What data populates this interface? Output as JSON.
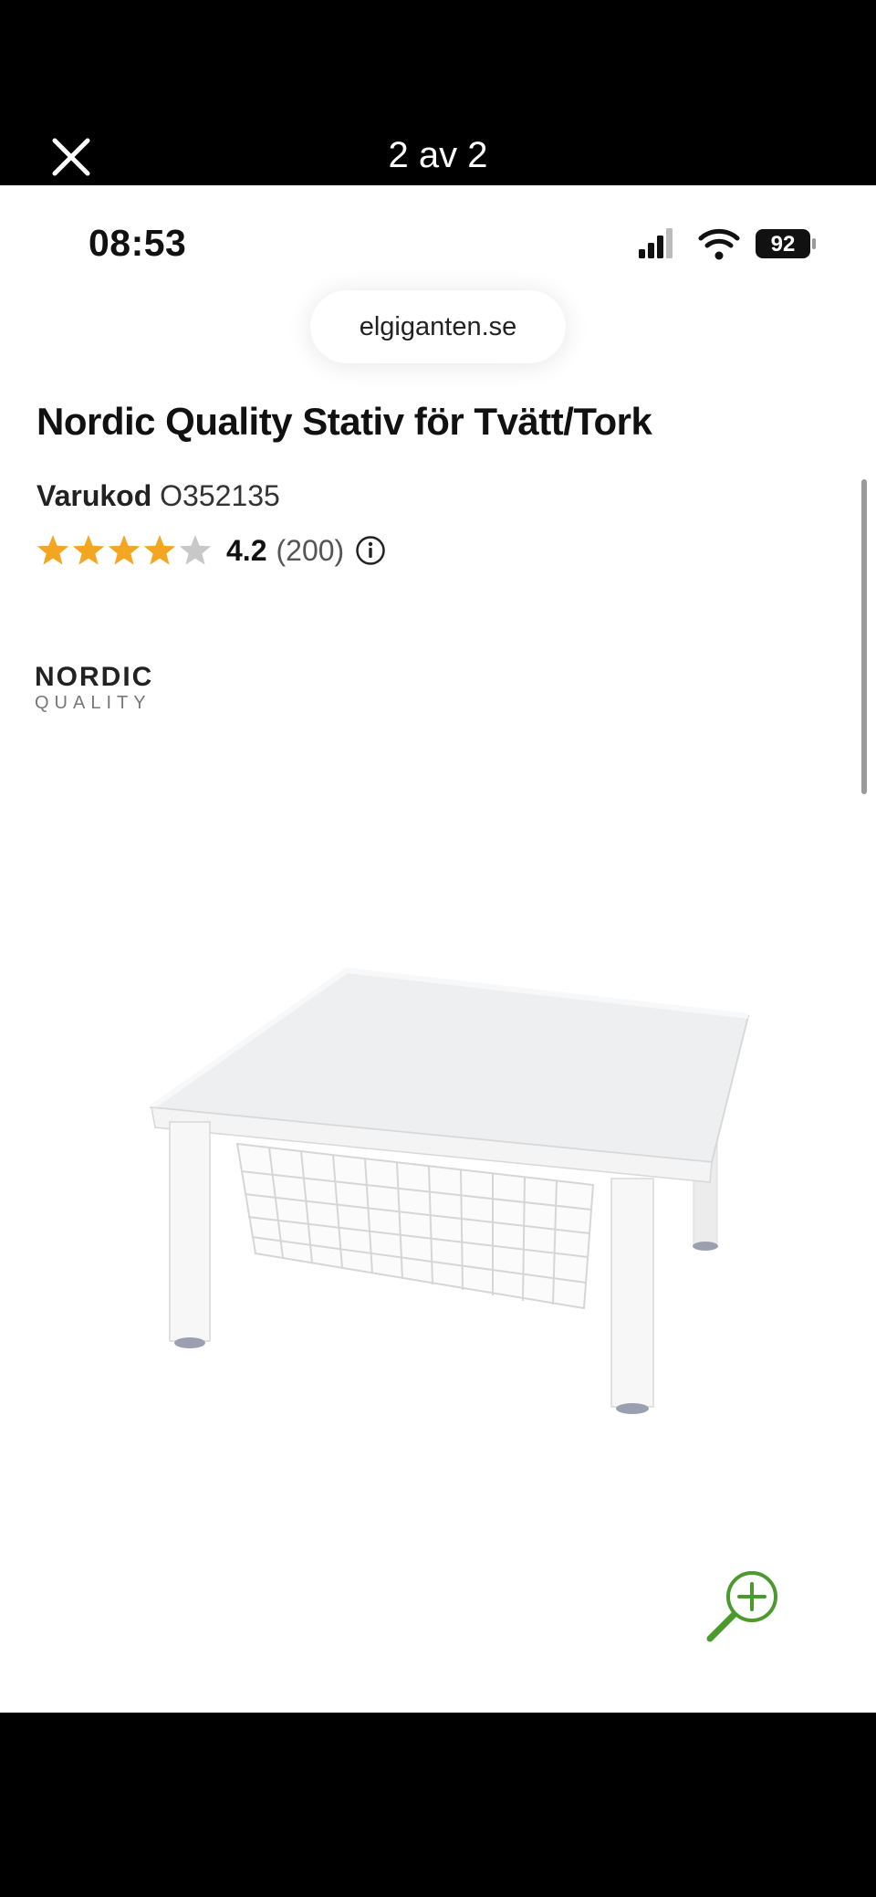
{
  "viewer": {
    "counter": "2 av 2"
  },
  "status_bar": {
    "time": "08:53",
    "battery": "92"
  },
  "browser": {
    "url": "elgiganten.se"
  },
  "product": {
    "title": "Nordic Quality Stativ för Tvätt/Tork",
    "sku_label": "Varukod",
    "sku_value": "O352135",
    "rating_value": "4.2",
    "rating_count": "(200)",
    "stars_filled": 4,
    "stars_total": 5,
    "brand_line1": "NORDIC",
    "brand_line2": "QUALITY"
  },
  "colors": {
    "star": "#f4a623",
    "star_empty": "#c8c8c8",
    "zoom": "#4a9a2e"
  },
  "icons": [
    "close-icon",
    "signal-icon",
    "wifi-icon",
    "battery-icon",
    "star-icon",
    "info-icon",
    "zoom-in-icon"
  ]
}
